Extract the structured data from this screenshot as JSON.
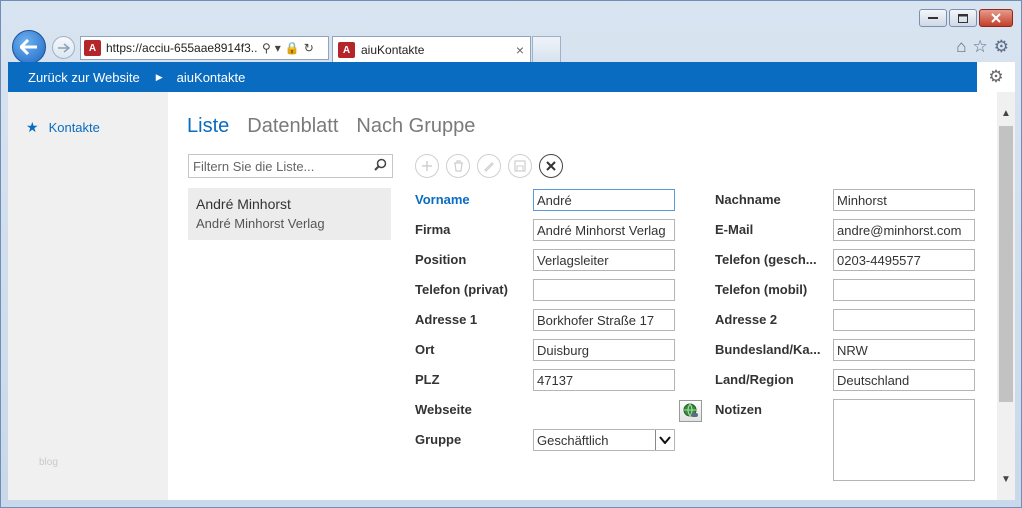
{
  "browser": {
    "url": "https://acciu-655aae8914f3...",
    "tab_title": "aiuKontakte",
    "app_icon_text": "A"
  },
  "topbar": {
    "back_link": "Zurück zur Website",
    "app_title": "aiuKontakte"
  },
  "sidebar": {
    "items": [
      {
        "label": "Kontakte",
        "icon": "star-icon"
      }
    ],
    "footer": "blog"
  },
  "views": {
    "tabs": [
      {
        "label": "Liste",
        "active": true
      },
      {
        "label": "Datenblatt",
        "active": false
      },
      {
        "label": "Nach Gruppe",
        "active": false
      }
    ]
  },
  "search": {
    "placeholder": "Filtern Sie die Liste..."
  },
  "list": {
    "items": [
      {
        "name": "André Minhorst",
        "company": "André Minhorst Verlag"
      }
    ]
  },
  "form": {
    "left": [
      {
        "label": "Vorname",
        "value": "André"
      },
      {
        "label": "Firma",
        "value": "André Minhorst Verlag"
      },
      {
        "label": "Position",
        "value": "Verlagsleiter"
      },
      {
        "label": "Telefon (privat)",
        "value": ""
      },
      {
        "label": "Adresse 1",
        "value": "Borkhofer Straße 17"
      },
      {
        "label": "Ort",
        "value": "Duisburg"
      },
      {
        "label": "PLZ",
        "value": "47137"
      },
      {
        "label": "Webseite",
        "value": ""
      },
      {
        "label": "Gruppe",
        "value": "Geschäftlich"
      }
    ],
    "right": [
      {
        "label": "Nachname",
        "value": "Minhorst"
      },
      {
        "label": "E-Mail",
        "value": "andre@minhorst.com"
      },
      {
        "label": "Telefon (gesch...",
        "value": "0203-4495577"
      },
      {
        "label": "Telefon (mobil)",
        "value": ""
      },
      {
        "label": "Adresse 2",
        "value": ""
      },
      {
        "label": "Bundesland/Ka...",
        "value": "NRW"
      },
      {
        "label": "Land/Region",
        "value": "Deutschland"
      },
      {
        "label": "Notizen",
        "value": ""
      }
    ]
  },
  "colors": {
    "accent": "#0a6cc0",
    "sidebar_bg": "#f0f0f0",
    "list_item_bg": "#ececec",
    "app_icon": "#b4262a"
  }
}
